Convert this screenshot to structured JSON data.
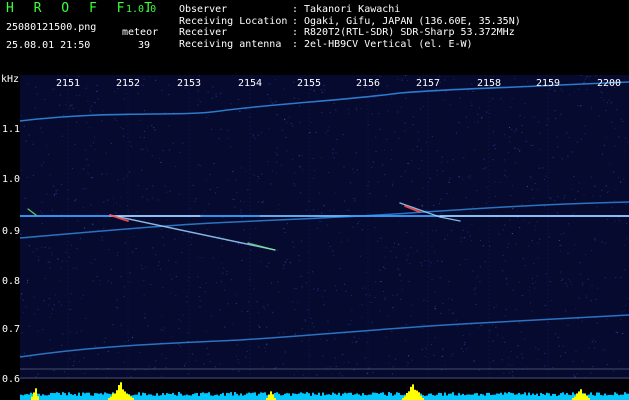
{
  "header": {
    "logo": "H R O F F T",
    "version": "1.0.0",
    "filename": "25080121500.png",
    "datetime": "25.08.01 21:50",
    "kind_label": "meteor",
    "count": "39",
    "info": [
      {
        "label": "Observer",
        "sep": ":",
        "value": "Takanori Kawachi"
      },
      {
        "label": "Receiving Location",
        "sep": ":",
        "value": "Ogaki, Gifu, JAPAN (136.60E, 35.35N)"
      },
      {
        "label": "Receiver",
        "sep": ":",
        "value": "R820T2(RTL-SDR) SDR-Sharp 53.372MHz"
      },
      {
        "label": "Receiving antenna",
        "sep": ":",
        "value": "2el-HB9CV Vertical (el. E-W)"
      }
    ]
  },
  "axis": {
    "unit": "kHz",
    "y_ticks": [
      "1.1",
      "1.0",
      "0.9",
      "0.8",
      "0.7",
      "0.6"
    ],
    "x_ticks": [
      "2151",
      "2152",
      "2153",
      "2154",
      "2155",
      "2156",
      "2157",
      "2158",
      "2159",
      "2200"
    ]
  },
  "colors": {
    "background": "#060a2e",
    "noise": "#1f3ca0",
    "trace": "#3aa0ff",
    "hot": "#ffffff",
    "echo": "#ff5050",
    "histogram_base": "#00c8ff",
    "histogram_peak": "#ffff00",
    "logo": "#3cff3c"
  }
}
